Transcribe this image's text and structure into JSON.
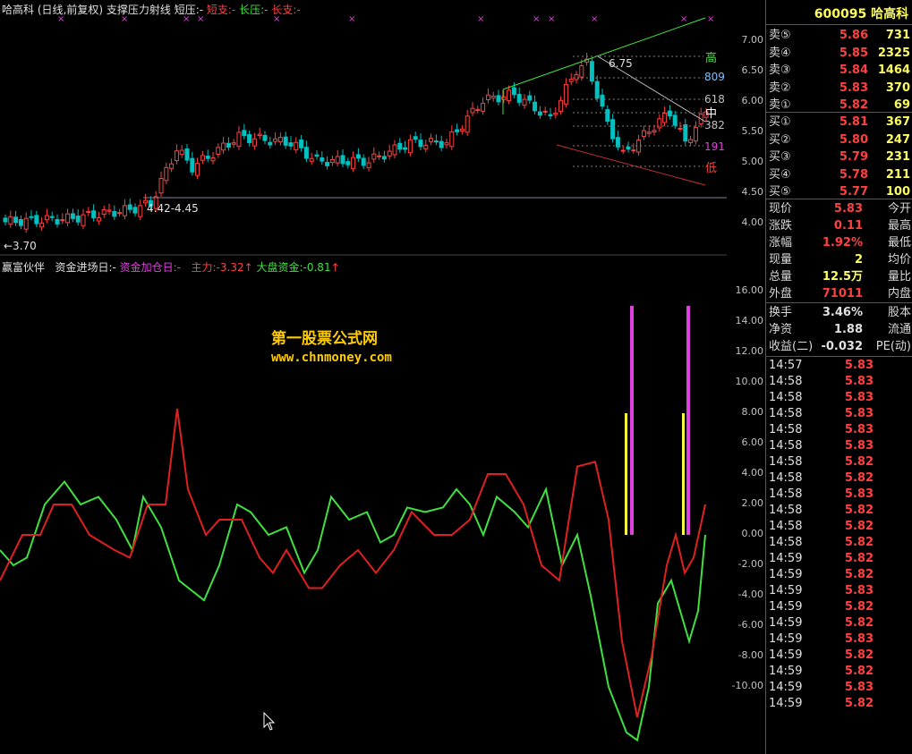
{
  "top_legend": {
    "stock": "哈高科",
    "mode": "(日线,前复权)",
    "indicator": "支撑压力射线",
    "short_pressure": "短压:-",
    "short_support": "短支:-",
    "long_pressure": "长压:-",
    "long_support": "长支:-"
  },
  "bottom_legend": {
    "name": "赢富伙伴",
    "entry_day": "资金进场日:-",
    "add_day": "资金加仓日:-",
    "main_force": "主力:-3.32",
    "market_funds": "大盘资金:-0.81"
  },
  "price_annotations": {
    "high_value": "6.75",
    "low_value": "←3.70",
    "range": "4.42-4.45",
    "fib_high": "高",
    "fib_809": "809",
    "fib_618": "618",
    "fib_mid": "中",
    "fib_382": "382",
    "fib_191": "191",
    "fib_low": "低"
  },
  "price_axis": [
    "7.00",
    "6.50",
    "6.00",
    "5.50",
    "5.00",
    "4.50",
    "4.00"
  ],
  "osc_axis": [
    "16.00",
    "14.00",
    "12.00",
    "10.00",
    "8.00",
    "6.00",
    "4.00",
    "2.00",
    "0.00",
    "-2.00",
    "-4.00",
    "-6.00",
    "-8.00",
    "-10.00"
  ],
  "watermark": {
    "line1": "第一股票公式网",
    "line2": "www.chnmoney.com"
  },
  "quote": {
    "code": "600095",
    "name": "哈高科",
    "asks": [
      {
        "label": "卖⑤",
        "price": "5.86",
        "vol": "731"
      },
      {
        "label": "卖④",
        "price": "5.85",
        "vol": "2325"
      },
      {
        "label": "卖③",
        "price": "5.84",
        "vol": "1464"
      },
      {
        "label": "卖②",
        "price": "5.83",
        "vol": "370"
      },
      {
        "label": "卖①",
        "price": "5.82",
        "vol": "69"
      }
    ],
    "bids": [
      {
        "label": "买①",
        "price": "5.81",
        "vol": "367"
      },
      {
        "label": "买②",
        "price": "5.80",
        "vol": "247"
      },
      {
        "label": "买③",
        "price": "5.79",
        "vol": "231"
      },
      {
        "label": "买④",
        "price": "5.78",
        "vol": "211"
      },
      {
        "label": "买⑤",
        "price": "5.77",
        "vol": "100"
      }
    ],
    "info": [
      {
        "label": "现价",
        "value": "5.83",
        "label2": "今开",
        "color": "#ff4040"
      },
      {
        "label": "涨跌",
        "value": "0.11",
        "label2": "最高",
        "color": "#ff4040"
      },
      {
        "label": "涨幅",
        "value": "1.92%",
        "label2": "最低",
        "color": "#ff4040"
      },
      {
        "label": "现量",
        "value": "2",
        "label2": "均价",
        "color": "#ffff60"
      },
      {
        "label": "总量",
        "value": "12.5万",
        "label2": "量比",
        "color": "#ffff60"
      },
      {
        "label": "外盘",
        "value": "71011",
        "label2": "内盘",
        "color": "#ff4040"
      }
    ],
    "info2": [
      {
        "label": "换手",
        "value": "3.46%",
        "label2": "股本",
        "color": "#e0e0e0"
      },
      {
        "label": "净资",
        "value": "1.88",
        "label2": "流通",
        "color": "#e0e0e0"
      },
      {
        "label": "收益(二)",
        "value": "-0.032",
        "label2": "PE(动)",
        "color": "#e0e0e0"
      }
    ],
    "ticks": [
      {
        "time": "14:57",
        "price": "5.83"
      },
      {
        "time": "14:58",
        "price": "5.83"
      },
      {
        "time": "14:58",
        "price": "5.83"
      },
      {
        "time": "14:58",
        "price": "5.83"
      },
      {
        "time": "14:58",
        "price": "5.83"
      },
      {
        "time": "14:58",
        "price": "5.83"
      },
      {
        "time": "14:58",
        "price": "5.82"
      },
      {
        "time": "14:58",
        "price": "5.82"
      },
      {
        "time": "14:58",
        "price": "5.83"
      },
      {
        "time": "14:58",
        "price": "5.82"
      },
      {
        "time": "14:58",
        "price": "5.82"
      },
      {
        "time": "14:58",
        "price": "5.82"
      },
      {
        "time": "14:59",
        "price": "5.82"
      },
      {
        "time": "14:59",
        "price": "5.82"
      },
      {
        "time": "14:59",
        "price": "5.83"
      },
      {
        "time": "14:59",
        "price": "5.82"
      },
      {
        "time": "14:59",
        "price": "5.82"
      },
      {
        "time": "14:59",
        "price": "5.83"
      },
      {
        "time": "14:59",
        "price": "5.82"
      },
      {
        "time": "14:59",
        "price": "5.82"
      },
      {
        "time": "14:59",
        "price": "5.83"
      },
      {
        "time": "14:59",
        "price": "5.82"
      }
    ]
  },
  "colors": {
    "up": "#ff4040",
    "down": "#00c0c0",
    "green_line": "#40e040",
    "red_line": "#e02020",
    "magenta": "#e040e0",
    "yellow": "#ffff40"
  }
}
